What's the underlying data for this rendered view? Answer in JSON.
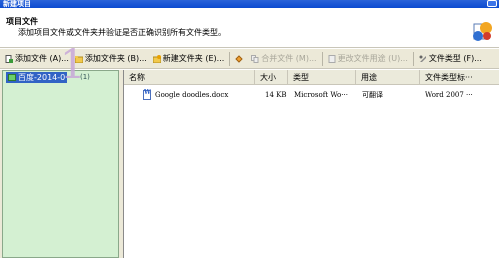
{
  "window": {
    "title": "新建项目"
  },
  "header": {
    "title": "项目文件",
    "description": "添加项目文件或文件夹并验证是否正确识别所有文件类型。"
  },
  "toolbar": {
    "items": [
      {
        "label": "添加文件 (A)...",
        "icon": "add-file-icon",
        "enabled": true
      },
      {
        "label": "添加文件夹 (B)...",
        "icon": "add-folder-icon",
        "enabled": true
      },
      {
        "label": "新建文件夹 (E)...",
        "icon": "new-folder-icon",
        "enabled": true
      },
      {
        "label": "合并文件 (M)...",
        "icon": "merge-files-icon",
        "enabled": false
      },
      {
        "label": "更改文件用途 (U)...",
        "icon": "change-usage-icon",
        "enabled": false
      },
      {
        "label": "文件类型 (F)...",
        "icon": "file-type-icon",
        "enabled": true
      }
    ]
  },
  "tree": {
    "selected_item": "百度-2014-0",
    "count": "(1)",
    "annotation": "1"
  },
  "file_list": {
    "columns": [
      "名称",
      "大小",
      "类型",
      "用途",
      "文件类型标···"
    ],
    "rows": [
      {
        "name": "Google doodles.docx",
        "size": "14 KB",
        "type": "Microsoft Wo···",
        "usage": "可翻译",
        "file_type": "Word 2007 ···"
      }
    ]
  },
  "colors": {
    "titlebar": "#0b4ad0",
    "tree_bg": "#d4f0d2",
    "selection": "#3163c5"
  }
}
